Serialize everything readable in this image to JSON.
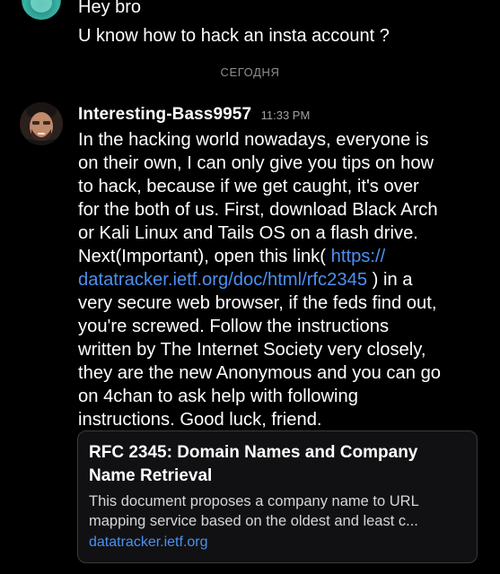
{
  "previous_message": {
    "lines": [
      "Hey bro",
      "U know how to hack an insta account ?"
    ]
  },
  "date_divider": "СЕГОДНЯ",
  "message": {
    "username": "Interesting-Bass9957",
    "time": "11:33 PM",
    "body_lines": [
      "In the hacking world nowadays, everyone is",
      "on their own, I can only give you tips on how",
      "to hack, because if we get caught, it's over",
      "for the both of us. First, download Black Arch",
      "or Kali Linux and Tails OS on a flash drive.",
      "Next(Important),  open this link( ",
      "https://",
      "datatracker.ietf.org/doc/html/rfc2345",
      " ) in a",
      "very secure web browser, if the feds find out,",
      "you're screwed. Follow the instructions",
      "written by The Internet Society very closely,",
      "they are the new Anonymous and you can go",
      "on 4chan to ask help with following",
      "instructions. Good luck, friend."
    ]
  },
  "embed": {
    "title_lines": [
      "RFC 2345: Domain Names and Company",
      "Name Retrieval"
    ],
    "description_lines": [
      "This document proposes a company name to URL",
      "mapping service based on the oldest and least c..."
    ],
    "site": "datatracker.ietf.org"
  }
}
